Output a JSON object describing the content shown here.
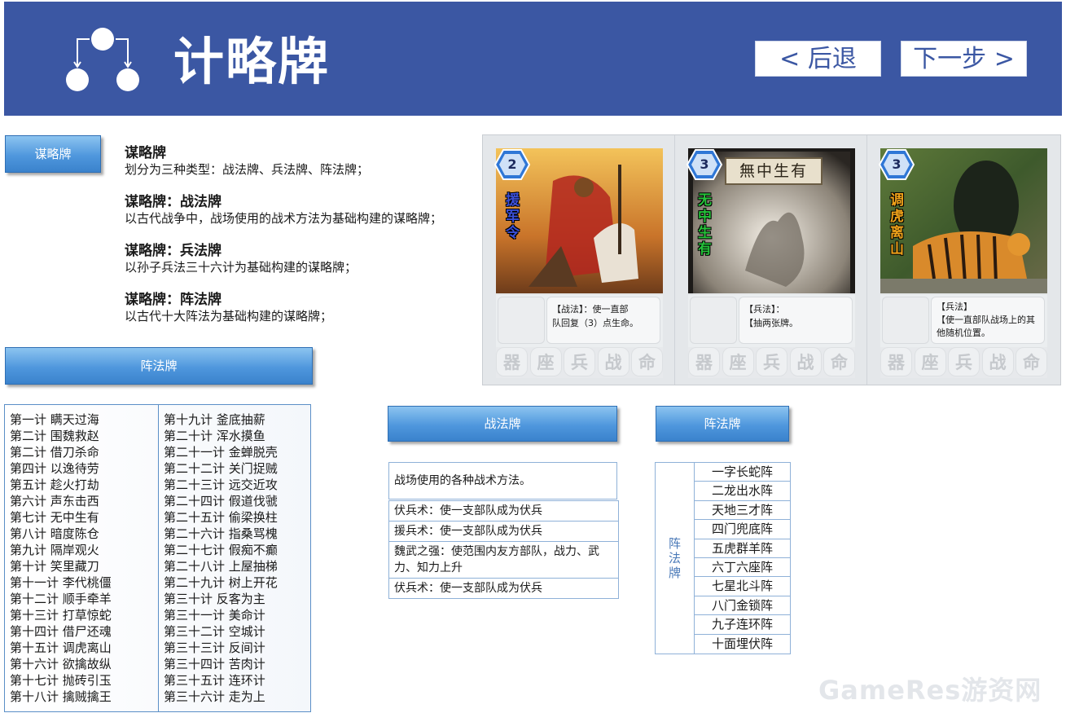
{
  "header": {
    "title": "计略牌",
    "back_label": "< 后退",
    "next_label": "下一步 >",
    "colors": {
      "bar": "#3b57a3",
      "button_text": "#3b57a3"
    }
  },
  "labels": {
    "strategy": "谋略牌",
    "formation_big": "阵法牌",
    "tactic": "战法牌",
    "formation_small": "阵法牌"
  },
  "intro": [
    {
      "head": "谋略牌",
      "text": "划分为三种类型：战法牌、兵法牌、阵法牌；"
    },
    {
      "head": "谋略牌：战法牌",
      "text": "以古代战争中，战场使用的战术方法为基础构建的谋略牌；"
    },
    {
      "head": "谋略牌：兵法牌",
      "text": "以孙子兵法三十六计为基础构建的谋略牌；"
    },
    {
      "head": "谋略牌：阵法牌",
      "text": "以古代十大阵法为基础构建的谋略牌；"
    }
  ],
  "cards": [
    {
      "cost": "2",
      "name": "援军令",
      "name_color": "#3a4fd8",
      "desc_line1": "【战法】：使一直部",
      "desc_line2": "队回复（3）点生命。",
      "art": "general"
    },
    {
      "cost": "3",
      "name": "无中生有",
      "name_color": "#25c23a",
      "desc_line1": "【兵法】：",
      "desc_line2": "【抽两张牌。",
      "art": "scroll",
      "art_caption": "無中生有"
    },
    {
      "cost": "3",
      "name": "调虎离山",
      "name_color": "#f0a21a",
      "desc_line1": "【兵法】",
      "desc_line2": "【使一直部队战场上的其他随机位置。",
      "art": "tiger"
    }
  ],
  "card_slots": [
    "器",
    "座",
    "兵",
    "战",
    "命"
  ],
  "strategies_col1": [
    "第一计 瞒天过海",
    "第二计 围魏救赵",
    "第二计 借刀杀命",
    "第四计 以逸待劳",
    "第五计 趁火打劫",
    "第六计 声东击西",
    "第七计 无中生有",
    "第八计 暗度陈仓",
    "第九计 隔岸观火",
    "第十计 笑里藏刀",
    "第十一计 李代桃僵",
    "第十二计 顺手牵羊",
    "第十三计 打草惊蛇",
    "第十四计 借尸还魂",
    "第十五计 调虎离山",
    "第十六计 欲擒故纵",
    "第十七计 抛砖引玉",
    "第十八计 擒贼擒王"
  ],
  "strategies_col2": [
    "第十九计 釜底抽薪",
    "第二十计 浑水摸鱼",
    "第二十一计 金蝉脱壳",
    "第二十二计 关门捉贼",
    "第二十三计 远交近攻",
    "第二十四计 假道伐虢",
    "第二十五计 偷梁换柱",
    "第二十六计 指桑骂槐",
    "第二十七计 假痴不癫",
    "第二十八计 上屋抽梯",
    "第二十九计 树上开花",
    "第三十计 反客为主",
    "第三十一计 美命计",
    "第三十二计 空城计",
    "第三十三计 反间计",
    "第三十四计 苦肉计",
    "第三十五计 连环计",
    "第三十六计 走为上"
  ],
  "tactics": {
    "head": "战场使用的各种战术方法。",
    "rows": [
      "伏兵术：使一支部队成为伏兵",
      "援兵术：使一支部队成为伏兵",
      "魏武之强：使范围内友方部队，战力、武力、知力上升",
      "伏兵术：使一支部队成为伏兵"
    ]
  },
  "formations": {
    "label": "阵法牌",
    "items": [
      "一字长蛇阵",
      "二龙出水阵",
      "天地三才阵",
      "四门兜底阵",
      "五虎群羊阵",
      "六丁六座阵",
      "七星北斗阵",
      "八门金锁阵",
      "九子连环阵",
      "十面埋伏阵"
    ]
  },
  "watermark": "GameRes游资网",
  "icons": {
    "logo": "network-icon",
    "cost_badge": "hexagon-icon"
  }
}
